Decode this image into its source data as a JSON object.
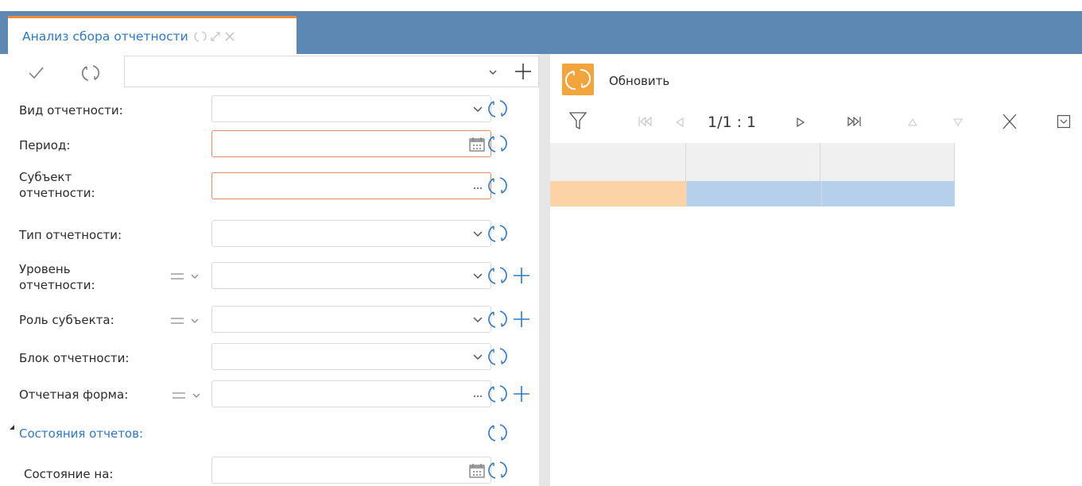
{
  "tab": {
    "title": "Анализ сбора отчетности"
  },
  "toolbar": {
    "refresh_label": "Обновить",
    "pager_text": "1/1 : 1"
  },
  "filters": [
    {
      "label": "Вид отчетности:"
    },
    {
      "label": "Период:"
    },
    {
      "label_line1": "Субъект",
      "label_line2": "отчетности:"
    },
    {
      "label": "Тип отчетности:"
    },
    {
      "label_line1": "Уровень",
      "label_line2": "отчетности:"
    },
    {
      "label": "Роль субъекта:"
    },
    {
      "label": "Блок отчетности:"
    },
    {
      "label": "Отчетная форма:"
    }
  ],
  "section": {
    "label": "Состояния отчетов:"
  },
  "state_field": {
    "label": "Состояние на:"
  },
  "colors": {
    "accent_blue": "#2f78c4",
    "tab_band": "#5d88b3",
    "refresh_orange": "#f3a43c",
    "required_border": "#e58b64",
    "grid_orange": "#fbd3a6",
    "grid_blue": "#b6d0ec"
  },
  "icons": [
    "check-icon",
    "refresh-icon",
    "chevron-down-icon",
    "plus-icon",
    "calendar-icon",
    "ellipsis-icon",
    "equals-icon",
    "filter-icon",
    "first-page-icon",
    "prev-page-icon",
    "next-page-icon",
    "last-page-icon",
    "sort-up-icon",
    "sort-down-icon",
    "clear-icon",
    "checkbox-icon",
    "collapse-triangle-icon"
  ]
}
